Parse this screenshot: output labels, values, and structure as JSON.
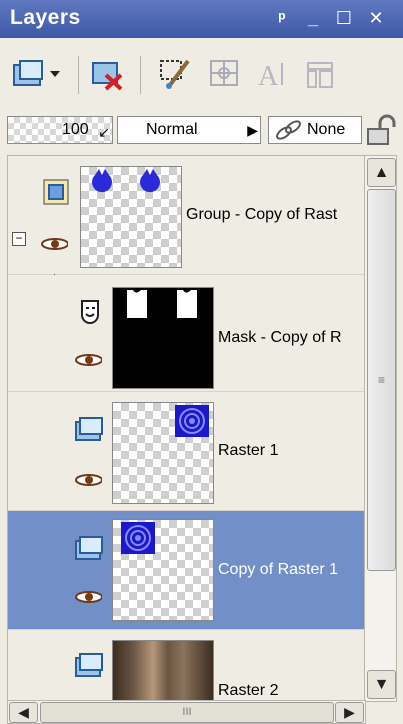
{
  "panel": {
    "title": "Layers",
    "controls": {
      "pin": "ᵖ",
      "minimize": "_",
      "maximize": "☐",
      "close": "✕"
    }
  },
  "toolbar": {
    "items": [
      {
        "name": "new-layer-icon"
      },
      {
        "name": "delete-layer-icon"
      },
      {
        "name": "edit-selection-icon"
      },
      {
        "name": "properties-icon"
      },
      {
        "name": "convert-text-icon",
        "disabled": true
      },
      {
        "name": "merge-icon",
        "disabled": true
      }
    ]
  },
  "options": {
    "opacity": "100",
    "blend_mode": "Normal",
    "link_set": "None"
  },
  "layers": [
    {
      "name": "Group - Copy of Rast",
      "type": "group",
      "visible": true
    },
    {
      "name": "Mask - Copy of R",
      "type": "mask",
      "visible": true
    },
    {
      "name": "Raster 1",
      "type": "raster",
      "visible": true
    },
    {
      "name": "Copy of Raster 1",
      "type": "raster",
      "visible": true,
      "selected": true
    },
    {
      "name": "Raster 2",
      "type": "raster",
      "visible": true
    }
  ],
  "scroll": {
    "up": "▲",
    "down": "▼",
    "grip": "≡",
    "left": "◀",
    "right": "▶",
    "hgrip": "III"
  },
  "colors": {
    "titlebar": "#4c67b4",
    "selected_row": "#738fc7",
    "blue_thumb": "#2424c8"
  }
}
